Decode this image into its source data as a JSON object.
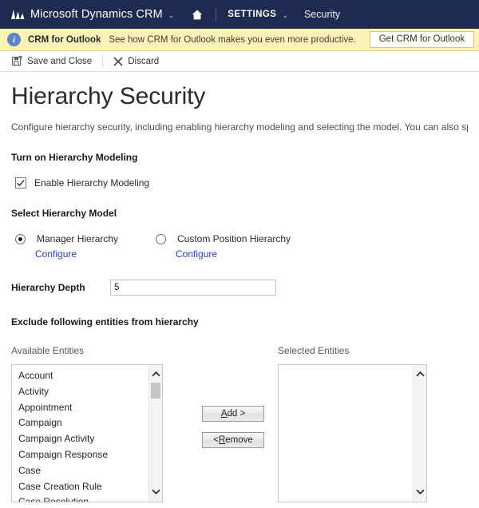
{
  "navbar": {
    "logo_icon": "dynamics-crm-logo-icon",
    "brand": "Microsoft Dynamics CRM",
    "brand_caret": "⌄",
    "home_icon": "home-icon",
    "settings_label": "SETTINGS",
    "settings_caret": "⌄",
    "breadcrumb": "Security"
  },
  "notification": {
    "icon": "info-icon",
    "icon_glyph": "i",
    "title": "CRM for Outlook",
    "message": "See how CRM for Outlook makes you even more productive.",
    "button_label": "Get CRM for Outlook"
  },
  "commandbar": {
    "save_icon": "save-and-close-icon",
    "save_label": "Save and Close",
    "discard_icon": "discard-icon",
    "discard_glyph": "✕",
    "discard_label": "Discard"
  },
  "page": {
    "title": "Hierarchy Security",
    "description": "Configure hierarchy security, including enabling hierarchy modeling and selecting the model. You can also specify h"
  },
  "modeling": {
    "section_title": "Turn on Hierarchy Modeling",
    "checkbox_label": "Enable Hierarchy Modeling",
    "checkbox_checked": true,
    "check_glyph": "✔"
  },
  "model": {
    "section_title": "Select Hierarchy Model",
    "options": [
      {
        "label": "Manager Hierarchy",
        "selected": true,
        "link": "Configure"
      },
      {
        "label": "Custom Position Hierarchy",
        "selected": false,
        "link": "Configure"
      }
    ]
  },
  "depth": {
    "label": "Hierarchy Depth",
    "value": "5",
    "placeholder": ""
  },
  "exclude": {
    "section_title": "Exclude following entities from hierarchy",
    "available_caption": "Available Entities",
    "selected_caption": "Selected Entities",
    "available_items": [
      "Account",
      "Activity",
      "Appointment",
      "Campaign",
      "Campaign Activity",
      "Campaign Response",
      "Case",
      "Case Creation Rule",
      "Case Resolution"
    ],
    "selected_items": [],
    "add_button": {
      "prefix": "",
      "accel": "A",
      "suffix": "dd >"
    },
    "remove_button": {
      "prefix": "< ",
      "accel": "R",
      "suffix": "emove"
    },
    "scroll_up_glyph": "⌃",
    "scroll_down_glyph": "⌄"
  },
  "colors": {
    "navbar_bg": "#1e2a4f",
    "notification_bg": "#fdf2b6",
    "link": "#2a40d0",
    "info_icon": "#5b85c5"
  }
}
